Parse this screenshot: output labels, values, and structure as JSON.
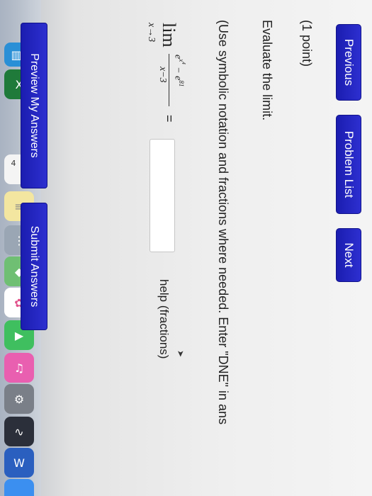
{
  "nav": {
    "previous": "Previous",
    "problem_list": "Problem List",
    "next": "Next"
  },
  "problem": {
    "points": "(1 point)",
    "prompt": "Evaluate the limit.",
    "instructions": "(Use symbolic notation and fractions where needed. Enter \"DNE\" in ans",
    "lim": "lim",
    "sub": "x→3",
    "numerator": "e^{x^4} − e^{81}",
    "denominator": "x−3",
    "equals": "=",
    "answer_value": "",
    "help_link": "help (fractions)"
  },
  "actions": {
    "preview": "Preview My Answers",
    "submit": "Submit Answers"
  },
  "dock": {
    "calendar_day": "4",
    "icons": [
      "numbers-icon",
      "excel-icon",
      "calendar-icon",
      "notes-icon",
      "launchpad-icon",
      "maps-icon",
      "photos-icon",
      "facetime-icon",
      "itunes-icon",
      "system-preferences-icon",
      "activity-monitor-icon",
      "word-icon",
      "messages-icon"
    ]
  }
}
